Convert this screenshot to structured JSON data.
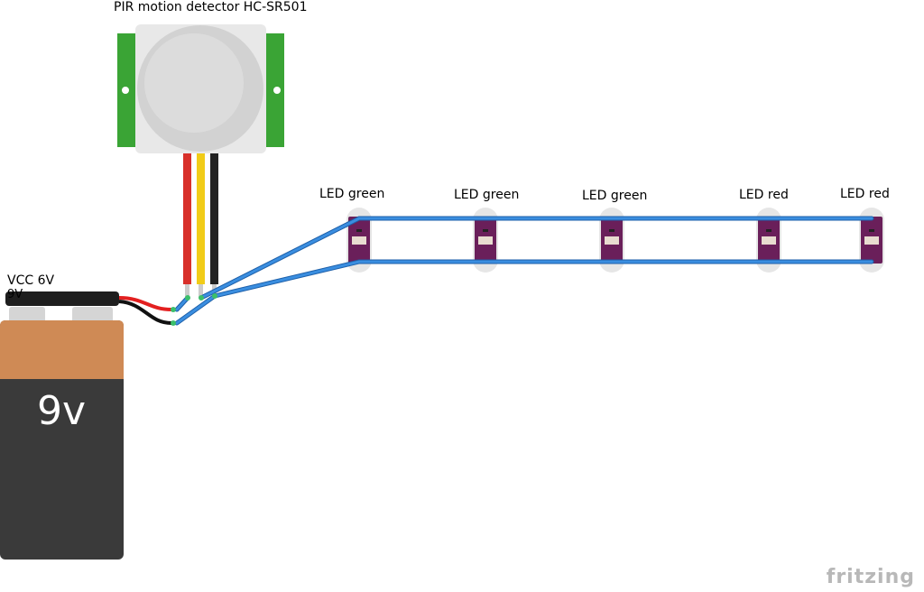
{
  "pir": {
    "label": "PIR motion detector HC-SR501"
  },
  "battery": {
    "label_vcc": "VCC 6V",
    "label_volt": "9V",
    "face_text": "9v"
  },
  "leds": [
    {
      "label": "LED green"
    },
    {
      "label": "LED green"
    },
    {
      "label": "LED green"
    },
    {
      "label": "LED red"
    },
    {
      "label": "LED red"
    }
  ],
  "logo": "fritzing",
  "colors": {
    "wire": "#2f7bcf",
    "led_board": "#6a1f5a",
    "pir_board": "#3aa435",
    "battery_top": "#cf8a55",
    "battery_body": "#3a3a3a"
  }
}
